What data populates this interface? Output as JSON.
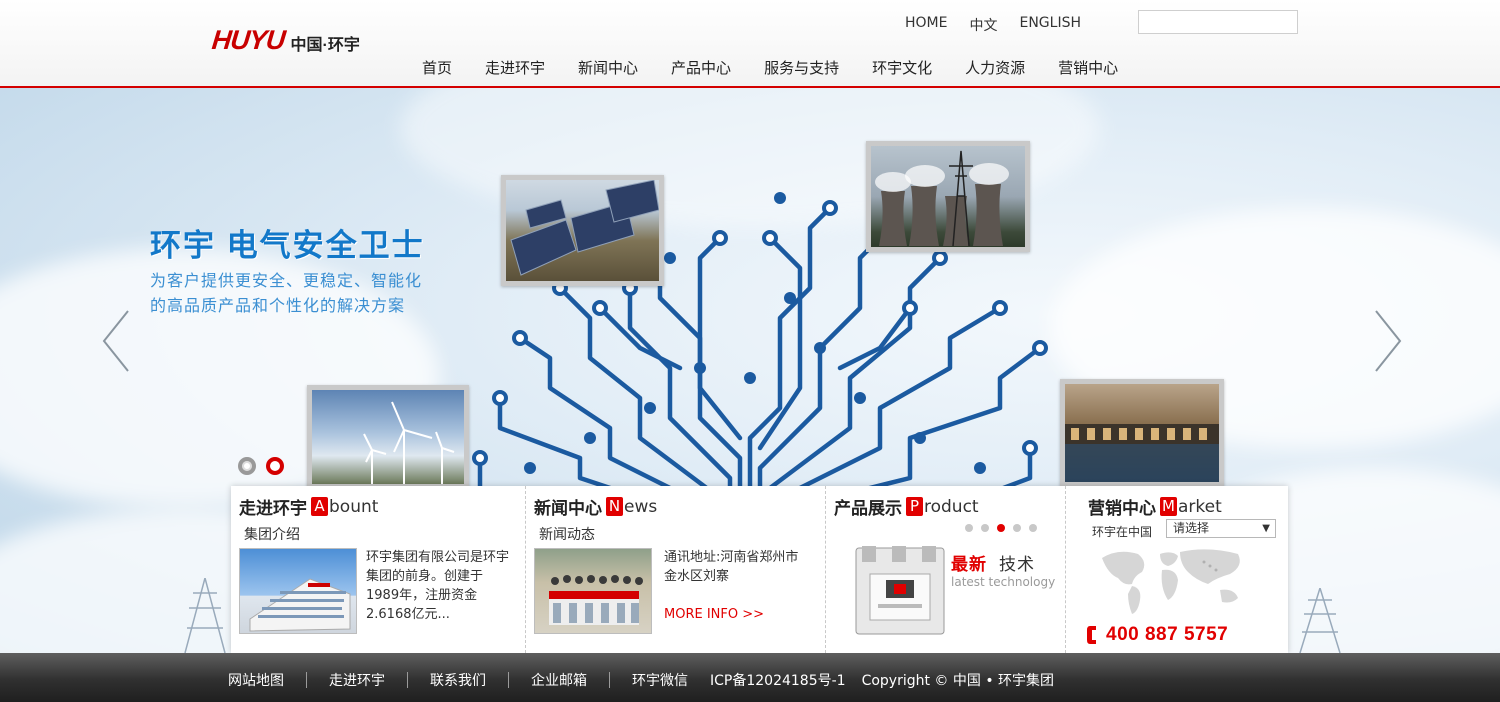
{
  "header": {
    "logo_mark": "HUYU",
    "logo_cn": "中国·环宇",
    "top_links": [
      "HOME",
      "中文",
      "ENGLISH"
    ],
    "search_placeholder": ""
  },
  "nav": [
    "首页",
    "走进环宇",
    "新闻中心",
    "产品中心",
    "服务与支持",
    "环宇文化",
    "人力资源",
    "营销中心"
  ],
  "banner": {
    "title": "环宇  电气安全卫士",
    "line1": "为客户提供更安全、更稳定、智能化",
    "line2": "的高品质产品和个性化的解决方案",
    "active_slide": 2,
    "slide_count": 2
  },
  "panels": {
    "about": {
      "title_cn": "走进环宇",
      "title_cap": "A",
      "title_rest": "bount",
      "subtitle": "集团介绍",
      "text": "环宇集团有限公司是环宇集团的前身。创建于1989年，注册资金2.6168亿元..."
    },
    "news": {
      "title_cn": "新闻中心",
      "title_cap": "N",
      "title_rest": "ews",
      "subtitle": "新闻动态",
      "text": "通讯地址:河南省郑州市金水区刘寨",
      "more": "MORE INFO >>"
    },
    "product": {
      "title_cn": "产品展示",
      "title_cap": "P",
      "title_rest": "roduct",
      "active_dot": 3,
      "dot_count": 5,
      "tech_red": "最新",
      "tech_gray": "技术",
      "tech_en": "latest technology"
    },
    "market": {
      "title_cn": "营销中心",
      "title_cap": "M",
      "title_rest": "arket",
      "region_label": "环宇在中国",
      "select_value": "请选择",
      "phone": "400 887 5757"
    }
  },
  "footer": {
    "links": [
      "网站地图",
      "走进环宇",
      "联系我们",
      "企业邮箱",
      "环宇微信"
    ],
    "icp": "ICP备12024185号-1",
    "copyright": "Copyright  ©  中国 •  环宇集团"
  },
  "colors": {
    "brand_red": "#e10000",
    "slogan_blue": "#1278c9",
    "circuit_blue": "#1b5aa0"
  }
}
